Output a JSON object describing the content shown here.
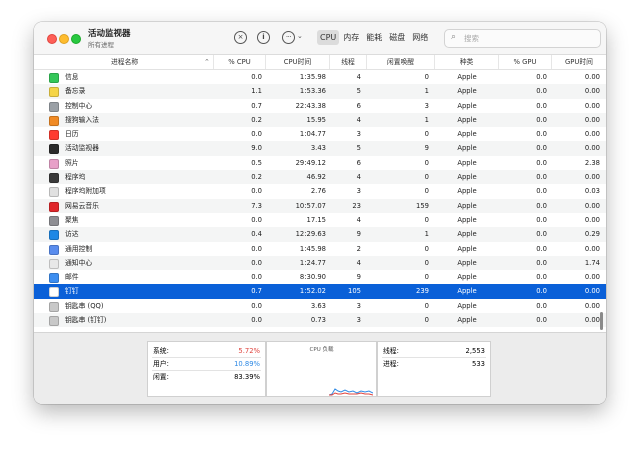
{
  "window": {
    "title": "活动监视器",
    "subtitle": "所有进程"
  },
  "toolbar": {
    "stop_icon": "×",
    "info_icon": "i",
    "more_icon": "···",
    "chevron": "⌄"
  },
  "tabs": [
    {
      "label": "CPU",
      "active": true
    },
    {
      "label": "内存",
      "active": false
    },
    {
      "label": "能耗",
      "active": false
    },
    {
      "label": "磁盘",
      "active": false
    },
    {
      "label": "网络",
      "active": false
    }
  ],
  "search": {
    "placeholder": "搜索"
  },
  "columns": {
    "name": "进程名称",
    "cpu": "% CPU",
    "cpu_time": "CPU时间",
    "threads": "线程",
    "idle_wakeups": "闲置唤醒",
    "kind": "种类",
    "gpu": "% GPU",
    "gpu_time": "GPU时间"
  },
  "processes": [
    {
      "name": "信息",
      "cpu": "0.0",
      "time": "1:35.98",
      "threads": "4",
      "wake": "0",
      "kind": "Apple",
      "gpu": "0.0",
      "gtime": "0.00",
      "color": "#34c759"
    },
    {
      "name": "备忘录",
      "cpu": "1.1",
      "time": "1:53.36",
      "threads": "5",
      "wake": "1",
      "kind": "Apple",
      "gpu": "0.0",
      "gtime": "0.00",
      "color": "#f5d547"
    },
    {
      "name": "控制中心",
      "cpu": "0.7",
      "time": "22:43.38",
      "threads": "6",
      "wake": "3",
      "kind": "Apple",
      "gpu": "0.0",
      "gtime": "0.00",
      "color": "#9aa0a6"
    },
    {
      "name": "搜狗输入法",
      "cpu": "0.2",
      "time": "15.95",
      "threads": "4",
      "wake": "1",
      "kind": "Apple",
      "gpu": "0.0",
      "gtime": "0.00",
      "color": "#f08a24"
    },
    {
      "name": "日历",
      "cpu": "0.0",
      "time": "1:04.77",
      "threads": "3",
      "wake": "0",
      "kind": "Apple",
      "gpu": "0.0",
      "gtime": "0.00",
      "color": "#ff3b30"
    },
    {
      "name": "活动监视器",
      "cpu": "9.0",
      "time": "3.43",
      "threads": "5",
      "wake": "9",
      "kind": "Apple",
      "gpu": "0.0",
      "gtime": "0.00",
      "color": "#2b2b2b"
    },
    {
      "name": "照片",
      "cpu": "0.5",
      "time": "29:49.12",
      "threads": "6",
      "wake": "0",
      "kind": "Apple",
      "gpu": "0.0",
      "gtime": "2.38",
      "color": "#e8a0c8"
    },
    {
      "name": "程序坞",
      "cpu": "0.2",
      "time": "46.92",
      "threads": "4",
      "wake": "0",
      "kind": "Apple",
      "gpu": "0.0",
      "gtime": "0.00",
      "color": "#3a3a3a"
    },
    {
      "name": "程序坞附加项",
      "cpu": "0.0",
      "time": "2.76",
      "threads": "3",
      "wake": "0",
      "kind": "Apple",
      "gpu": "0.0",
      "gtime": "0.03",
      "color": "#e0e0e0"
    },
    {
      "name": "网易云音乐",
      "cpu": "7.3",
      "time": "10:57.07",
      "threads": "23",
      "wake": "159",
      "kind": "Apple",
      "gpu": "0.0",
      "gtime": "0.00",
      "color": "#e0262a"
    },
    {
      "name": "聚焦",
      "cpu": "0.0",
      "time": "17.15",
      "threads": "4",
      "wake": "0",
      "kind": "Apple",
      "gpu": "0.0",
      "gtime": "0.00",
      "color": "#8e8e93"
    },
    {
      "name": "访达",
      "cpu": "0.4",
      "time": "12:29.63",
      "threads": "9",
      "wake": "1",
      "kind": "Apple",
      "gpu": "0.0",
      "gtime": "0.29",
      "color": "#1e88e5"
    },
    {
      "name": "通用控制",
      "cpu": "0.0",
      "time": "1:45.98",
      "threads": "2",
      "wake": "0",
      "kind": "Apple",
      "gpu": "0.0",
      "gtime": "0.00",
      "color": "#5a8dee"
    },
    {
      "name": "通知中心",
      "cpu": "0.0",
      "time": "1:24.77",
      "threads": "4",
      "wake": "0",
      "kind": "Apple",
      "gpu": "0.0",
      "gtime": "1.74",
      "color": "#e8e8e8"
    },
    {
      "name": "邮件",
      "cpu": "0.0",
      "time": "8:30.90",
      "threads": "9",
      "wake": "0",
      "kind": "Apple",
      "gpu": "0.0",
      "gtime": "0.00",
      "color": "#3d8ef0"
    },
    {
      "name": "钉钉",
      "cpu": "0.7",
      "time": "1:52.02",
      "threads": "105",
      "wake": "239",
      "kind": "Apple",
      "gpu": "0.0",
      "gtime": "0.00",
      "color": "#ffffff"
    },
    {
      "name": "钥匙串 (QQ)",
      "cpu": "0.0",
      "time": "3.63",
      "threads": "3",
      "wake": "0",
      "kind": "Apple",
      "gpu": "0.0",
      "gtime": "0.00",
      "color": "#c8c8c8"
    },
    {
      "name": "钥匙串 (钉钉)",
      "cpu": "0.0",
      "time": "0.73",
      "threads": "3",
      "wake": "0",
      "kind": "Apple",
      "gpu": "0.0",
      "gtime": "0.00",
      "color": "#c8c8c8"
    }
  ],
  "selected_index": 15,
  "summary": {
    "system_label": "系统:",
    "system_value": "5.72%",
    "user_label": "用户:",
    "user_value": "10.89%",
    "idle_label": "闲置:",
    "idle_value": "83.39%",
    "load_title": "CPU 负载",
    "threads_label": "线程:",
    "threads_value": "2,553",
    "procs_label": "进程:",
    "procs_value": "533",
    "system_color": "#e0443e",
    "user_color": "#2f8ae5"
  }
}
